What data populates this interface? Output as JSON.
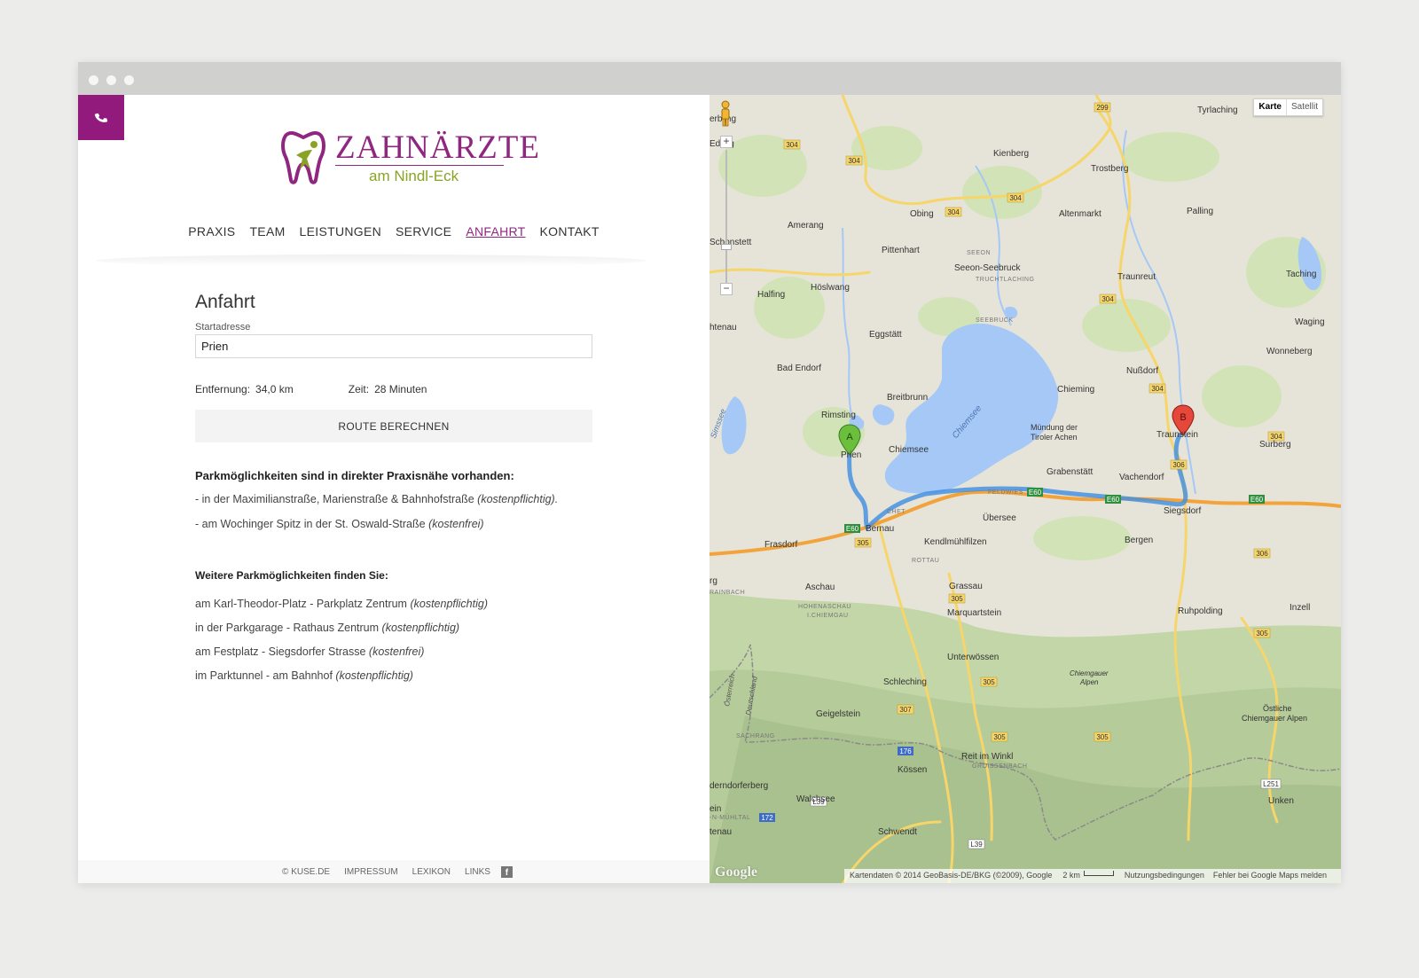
{
  "site": {
    "logo_title": "ZAHNÄRZTE",
    "logo_subtitle": "am Nindl-Eck",
    "brand_color": "#8f2680",
    "accent_color": "#8aa326"
  },
  "nav": {
    "items": [
      {
        "label": "PRAXIS"
      },
      {
        "label": "TEAM"
      },
      {
        "label": "LEISTUNGEN"
      },
      {
        "label": "SERVICE"
      },
      {
        "label": "ANFAHRT",
        "active": true
      },
      {
        "label": "KONTAKT"
      }
    ]
  },
  "route": {
    "heading": "Anfahrt",
    "start_label": "Startadresse",
    "start_value": "Prien",
    "distance_label": "Entfernung:",
    "distance_value": "34,0 km",
    "time_label": "Zeit:",
    "time_value": "28 Minuten",
    "button_label": "ROUTE BERECHNEN"
  },
  "parking": {
    "heading": "Parkmöglichkeiten sind in direkter Praxisnähe vorhanden:",
    "near": [
      {
        "text": "- in der Maximilianstraße, Marienstraße & Bahnhofstraße ",
        "note": "(kostenpflichtig)."
      },
      {
        "text": "- am Wochinger Spitz in der St. Oswald-Straße ",
        "note": "(kostenfrei)"
      }
    ],
    "more_heading": "Weitere Parkmöglichkeiten finden Sie:",
    "more": [
      {
        "text": "am Karl-Theodor-Platz - Parkplatz Zentrum ",
        "note": "(kostenpflichtig)"
      },
      {
        "text": "in der Parkgarage - Rathaus Zentrum ",
        "note": "(kostenpflichtig)"
      },
      {
        "text": "am Festplatz - Siegsdorfer Strasse ",
        "note": "(kostenfrei)"
      },
      {
        "text": "im Parktunnel - am Bahnhof ",
        "note": "(kostenpflichtig)"
      }
    ]
  },
  "footer": {
    "copyright": "© KUSE.DE",
    "links": [
      "IMPRESSUM",
      "LEXIKON",
      "LINKS"
    ],
    "facebook_glyph": "f"
  },
  "map": {
    "type_karte": "Karte",
    "type_satellit": "Satellit",
    "zoom_in": "+",
    "zoom_out": "−",
    "marker_a": "A",
    "marker_b": "B",
    "places": {
      "tyrlaching": "Tyrlaching",
      "kienberg": "Kienberg",
      "trostberg": "Trostberg",
      "obing": "Obing",
      "altenmarkt": "Altenmarkt",
      "palling": "Palling",
      "amerang": "Amerang",
      "schonstett": "Schonstett",
      "pittenhart": "Pittenhart",
      "seeon_seebruck": "Seeon-Seebruck",
      "traunreut": "Traunreut",
      "taching": "Taching",
      "halfing": "Halfing",
      "hoeslwang": "Höslwang",
      "eggstaett": "Eggstätt",
      "waging": "Waging",
      "bad_endorf": "Bad Endorf",
      "nussdorf": "Nußdorf",
      "wonneberg": "Wonneberg",
      "breitbrunn": "Breitbrunn",
      "chieming": "Chieming",
      "rimsting": "Rimsting",
      "chiemsee_island": "Chiemsee",
      "chiemsee_lake": "Chiemsee",
      "muendung": "Mündung der",
      "muendung2": "Tiroler Achen",
      "traunstein": "Traunstein",
      "surberg": "Surberg",
      "prien": "Prien",
      "grabenstaett": "Grabenstätt",
      "vachendorf": "Vachendorf",
      "siegsdorf": "Siegsdorf",
      "uebersee": "Übersee",
      "bernau": "Bernau",
      "frasdorf": "Frasdorf",
      "kendlmuehlfilzen": "Kendlmühlfilzen",
      "bergen": "Bergen",
      "aschau": "Aschau",
      "grassau": "Grassau",
      "marquartstein": "Marquartstein",
      "ruhpolding": "Ruhpolding",
      "inzell": "Inzell",
      "unterwoessen": "Unterwössen",
      "schleching": "Schleching",
      "geigelstein": "Geigelstein",
      "reit_im_winkl": "Reit im Winkl",
      "koessen": "Kössen",
      "oestliche": "Östliche",
      "chiemgauer_alpen": "Chiemgauer Alpen",
      "walchsee": "Walchsee",
      "schwendt": "Schwendt",
      "unken": "Unken",
      "osterreich": "Österreich",
      "deutschland": "Deutschland",
      "chiemgauer_alpen_small": "Chiemgauer",
      "alpen_small": "Alpen",
      "simssee": "Simssee",
      "seeon": "SEEON",
      "truchtlaching": "TRUCHTLACHING",
      "seebruck": "SEEBRUCK",
      "feldwies": "FELDWIES",
      "rottau": "ROTTAU",
      "hohenaschau": "HOHENASCHAU",
      "im_chiemgau": "I.CHIEMGAU",
      "sachrang": "SACHRANG",
      "groissenbach": "GROISSENBACH",
      "chet": "CHET",
      "rainbach": "RAINBACH",
      "n_muehltal": "-N-MÜHLTAL",
      "edling": "Edling",
      "erbling": "erbling",
      "htenau": "htenau",
      "rg": "rg",
      "tenau": "tenau",
      "derndorferberg": "derndorferberg",
      "ein": "ein"
    },
    "roads": {
      "r304": "304",
      "r299": "299",
      "r305": "305",
      "r306": "306",
      "r307": "307",
      "r176": "176",
      "r172": "172",
      "e60": "E60",
      "l39": "L39",
      "l251": "L251"
    },
    "attribution": "Kartendaten © 2014 GeoBasis-DE/BKG (©2009), Google",
    "scale": "2 km",
    "terms": "Nutzungsbedingungen",
    "report": "Fehler bei Google Maps melden",
    "google": "Google"
  }
}
